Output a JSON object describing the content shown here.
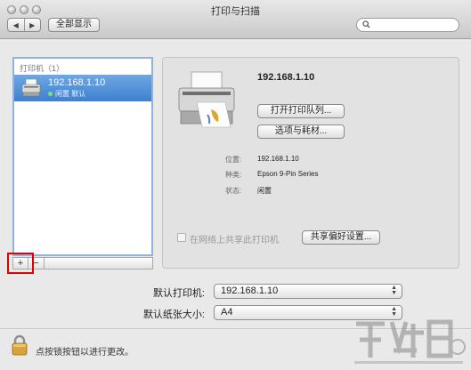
{
  "window": {
    "title": "打印与扫描",
    "show_all_label": "全部显示",
    "nav": {
      "back": "◀",
      "forward": "▶"
    },
    "search": {
      "value": "",
      "placeholder": ""
    }
  },
  "printer_list": {
    "header": "打印机（1）",
    "items": [
      {
        "name": "192.168.1.10",
        "status": "闲置  默认"
      }
    ],
    "add_label": "+",
    "remove_label": "−"
  },
  "details": {
    "name": "192.168.1.10",
    "open_queue_label": "打开打印队列...",
    "options_label": "选项与耗材...",
    "location_label": "位置:",
    "location_value": "192.168.1.10",
    "kind_label": "种类:",
    "kind_value": "Epson 9-Pin Series",
    "status_label": "状态:",
    "status_value": "闲置",
    "share_label": "在网络上共享此打印机",
    "share_checked": false,
    "share_prefs_label": "共享偏好设置..."
  },
  "defaults": {
    "printer_label": "默认打印机:",
    "printer_value": "192.168.1.10",
    "paper_label": "默认纸张大小:",
    "paper_value": "A4"
  },
  "lock_text": "点按锁按钮以进行更改。",
  "colors": {
    "selection": "#3e7fcf",
    "highlight_box": "#e00000"
  }
}
